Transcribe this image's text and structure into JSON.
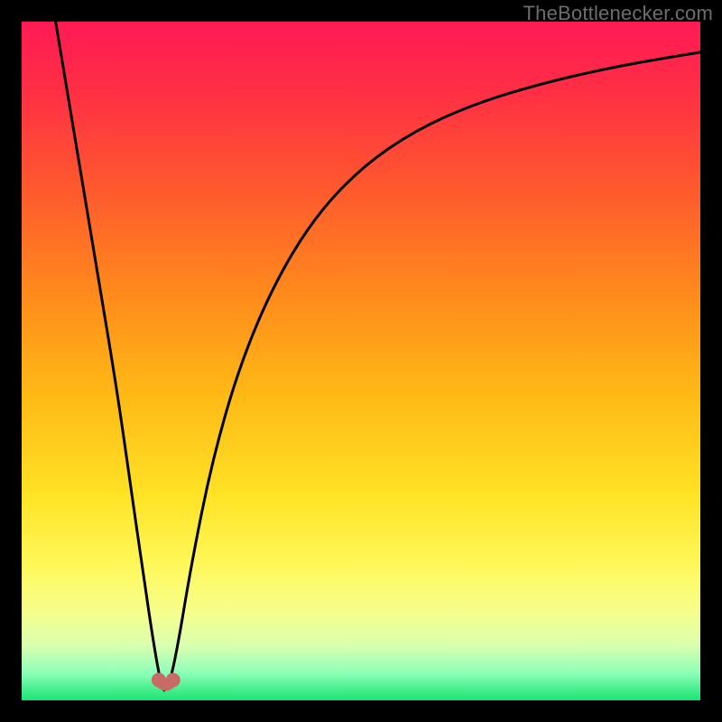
{
  "watermark": {
    "text": "TheBottlenecker.com"
  },
  "colors": {
    "frame": "#000000",
    "curve": "#000000",
    "marker": "#c76b67",
    "gradient_stops": [
      {
        "offset": 0.0,
        "color": "#ff1a55"
      },
      {
        "offset": 0.1,
        "color": "#ff2e45"
      },
      {
        "offset": 0.25,
        "color": "#ff5a2d"
      },
      {
        "offset": 0.4,
        "color": "#ff8a1c"
      },
      {
        "offset": 0.55,
        "color": "#ffb915"
      },
      {
        "offset": 0.7,
        "color": "#ffe326"
      },
      {
        "offset": 0.8,
        "color": "#fff85a"
      },
      {
        "offset": 0.87,
        "color": "#f6ff8d"
      },
      {
        "offset": 0.92,
        "color": "#d9ffb0"
      },
      {
        "offset": 0.96,
        "color": "#8cffb8"
      },
      {
        "offset": 1.0,
        "color": "#19e472"
      }
    ]
  },
  "chart_data": {
    "type": "line",
    "title": "",
    "xlabel": "",
    "ylabel": "",
    "xlim": [
      0,
      100
    ],
    "ylim": [
      0,
      100
    ],
    "optimum_x": 21,
    "series": [
      {
        "name": "bottleneck-curve",
        "x": [
          5,
          8,
          11,
          14,
          16,
          18,
          19.5,
          20.5,
          21,
          21.8,
          23,
          25,
          28,
          32,
          37,
          43,
          50,
          58,
          67,
          77,
          88,
          100
        ],
        "y": [
          100,
          82,
          64,
          46,
          32,
          18,
          8,
          2.5,
          1.5,
          2.5,
          8,
          20,
          35,
          49,
          61,
          71,
          78.5,
          84,
          88,
          91,
          93.5,
          95.5
        ]
      }
    ],
    "markers": [
      {
        "name": "optimum-left",
        "x": 20.2,
        "y": 3.0
      },
      {
        "name": "optimum-right",
        "x": 22.3,
        "y": 3.0
      }
    ],
    "annotations": []
  }
}
